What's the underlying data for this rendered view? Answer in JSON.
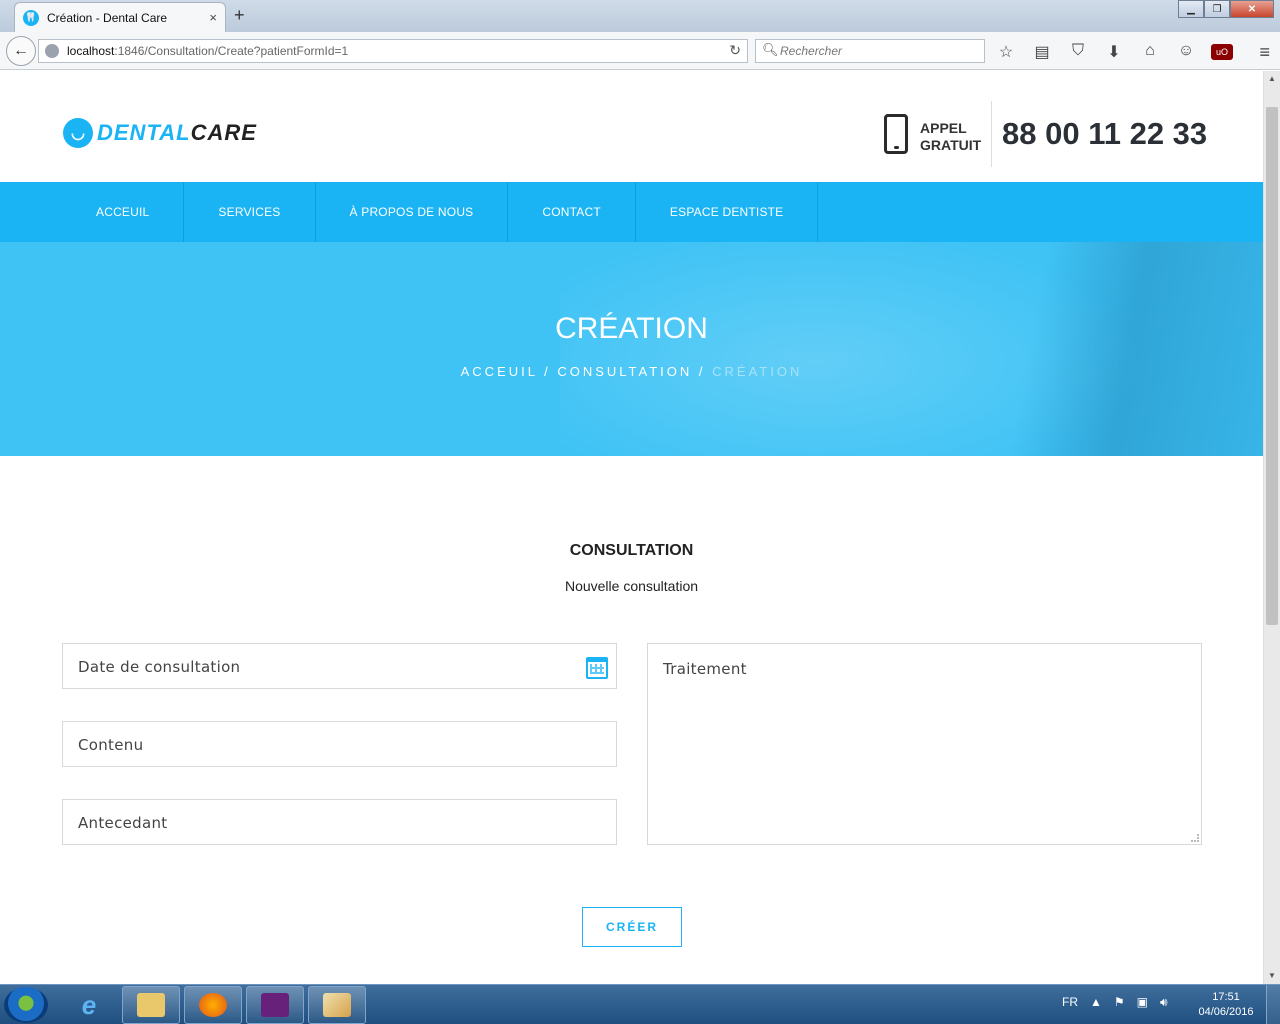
{
  "browser": {
    "tab_title": "Création - Dental Care",
    "tab_close": "×",
    "new_tab": "+",
    "url_host": "localhost",
    "url_rest": ":1846/Consultation/Create?patientFormId=1",
    "search_placeholder": "Rechercher",
    "win_minimize": "▁",
    "win_restore": "❐",
    "win_close": "✕"
  },
  "header": {
    "logo_dental": "DENTAL",
    "logo_care": "CARE",
    "appel_line1": "APPEL",
    "appel_line2": "GRATUIT",
    "phone_number": "88 00 11 22 33"
  },
  "nav": {
    "items": [
      {
        "label": "ACCEUIL"
      },
      {
        "label": "SERVICES"
      },
      {
        "label": "À PROPOS DE NOUS"
      },
      {
        "label": "CONTACT"
      },
      {
        "label": "ESPACE DENTISTE"
      }
    ]
  },
  "hero": {
    "title": "CRÉATION",
    "crumb_home": "ACCEUIL",
    "crumb_sep": " / ",
    "crumb_section": "CONSULTATION",
    "crumb_current": "CRÉATION"
  },
  "form": {
    "section_title": "CONSULTATION",
    "subtitle": "Nouvelle consultation",
    "date_placeholder": "Date de consultation",
    "contenu_placeholder": "Contenu",
    "antecedant_placeholder": "Antecedant",
    "traitement_placeholder": "Traitement",
    "submit_label": "CRÉER"
  },
  "taskbar": {
    "language": "FR",
    "time": "17:51",
    "date": "04/06/2016"
  },
  "colors": {
    "accent": "#1ab4f5",
    "hero_bg": "#3fc3f5",
    "dark_text": "#2b2f36"
  }
}
